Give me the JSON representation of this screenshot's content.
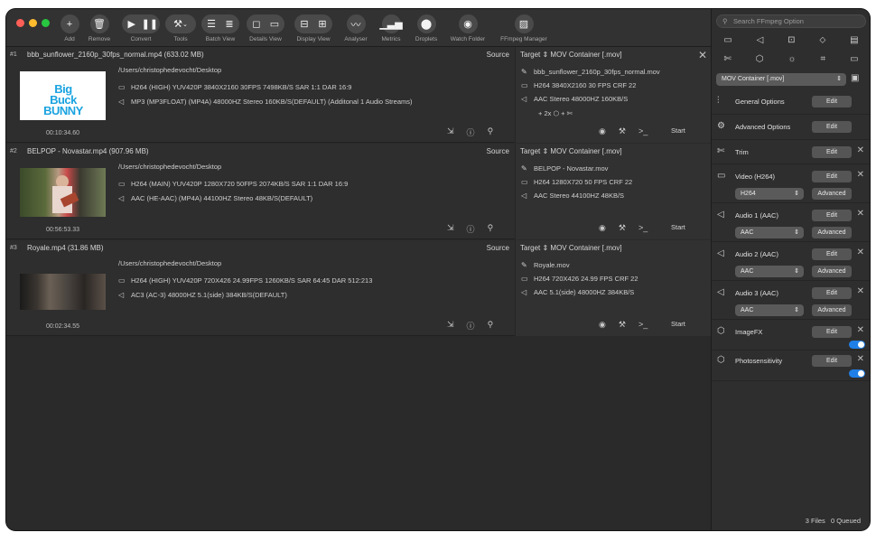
{
  "colors": {
    "close": "#ff5f57",
    "minimize": "#febc2e",
    "zoom": "#28c840",
    "accent": "#1f7fe6"
  },
  "toolbar": {
    "add": "Add",
    "remove": "Remove",
    "convert": "Convert",
    "tools": "Tools",
    "batch_view": "Batch View",
    "details_view": "Details View",
    "display_view": "Display View",
    "analyser": "Analyser",
    "metrics": "Metrics",
    "droplets": "Droplets",
    "watch_folder": "Watch Folder",
    "ffmpeg_manager": "FFmpeg Manager"
  },
  "jobs": [
    {
      "num": "#1",
      "name": "bbb_sunflower_2160p_30fps_normal.mp4",
      "size": "(633.02 MB)",
      "path": "/Users/christophedevocht/Desktop",
      "video": "H264 (HIGH) YUV420P 3840X2160  30FPS 7498KB/S SAR 1:1 DAR 16:9",
      "audio": "MP3 (MP3FLOAT) (MP4A) 48000HZ Stereo 160KB/S(DEFAULT) (Additonal 1 Audio Streams)",
      "duration": "00:10:34.60",
      "source_label": "Source",
      "target_label": "Target",
      "container": "MOV Container [.mov]",
      "out_name": "bbb_sunflower_2160p_30fps_normal.mov",
      "out_video": "H264 3840X2160 30 FPS CRF 22",
      "out_audio": "AAC Stereo 48000HZ 160KB/S",
      "extra": "+ 2x",
      "start": "Start",
      "thumb_text1": "Big Buck",
      "thumb_text2": "BUNNY"
    },
    {
      "num": "#2",
      "name": "BELPOP  - Novastar.mp4",
      "size": "(907.96 MB)",
      "path": "/Users/christophedevocht/Desktop",
      "video": "H264 (MAIN) YUV420P 1280X720  50FPS 2074KB/S SAR 1:1 DAR 16:9",
      "audio": "AAC (HE-AAC) (MP4A) 44100HZ Stereo 48KB/S(DEFAULT)",
      "duration": "00:56:53.33",
      "source_label": "Source",
      "target_label": "Target",
      "container": "MOV Container [.mov]",
      "out_name": "BELPOP  - Novastar.mov",
      "out_video": "H264 1280X720 50 FPS CRF 22",
      "out_audio": "AAC Stereo 44100HZ 48KB/S",
      "start": "Start"
    },
    {
      "num": "#3",
      "name": "Royale.mp4",
      "size": "(31.86 MB)",
      "path": "/Users/christophedevocht/Desktop",
      "video": "H264 (HIGH) YUV420P 720X426  24.99FPS 1260KB/S SAR 64:45 DAR 512:213",
      "audio": "AC3 (AC-3) 48000HZ 5.1(side) 384KB/S(DEFAULT)",
      "duration": "00:02:34.55",
      "source_label": "Source",
      "target_label": "Target",
      "container": "MOV Container [.mov]",
      "out_name": "Royale.mov",
      "out_video": "H264 720X426 24.99 FPS CRF 22",
      "out_audio": "AAC 5.1(side) 48000HZ 384KB/S",
      "start": "Start"
    }
  ],
  "sidebar": {
    "search_placeholder": "Search FFmpeg Option",
    "container": "MOV Container [.mov]",
    "general": "General Options",
    "advanced_opts": "Advanced Options",
    "trim": "Trim",
    "video": "Video (H264)",
    "video_codec": "H264",
    "audio1": "Audio 1 (AAC)",
    "audio2": "Audio 2 (AAC)",
    "audio3": "Audio 3 (AAC)",
    "audio_codec": "AAC",
    "imagefx": "ImageFX",
    "photosens": "Photosensitivity",
    "edit": "Edit",
    "advanced": "Advanced",
    "files": "3 Files",
    "queued": "0 Queued"
  }
}
